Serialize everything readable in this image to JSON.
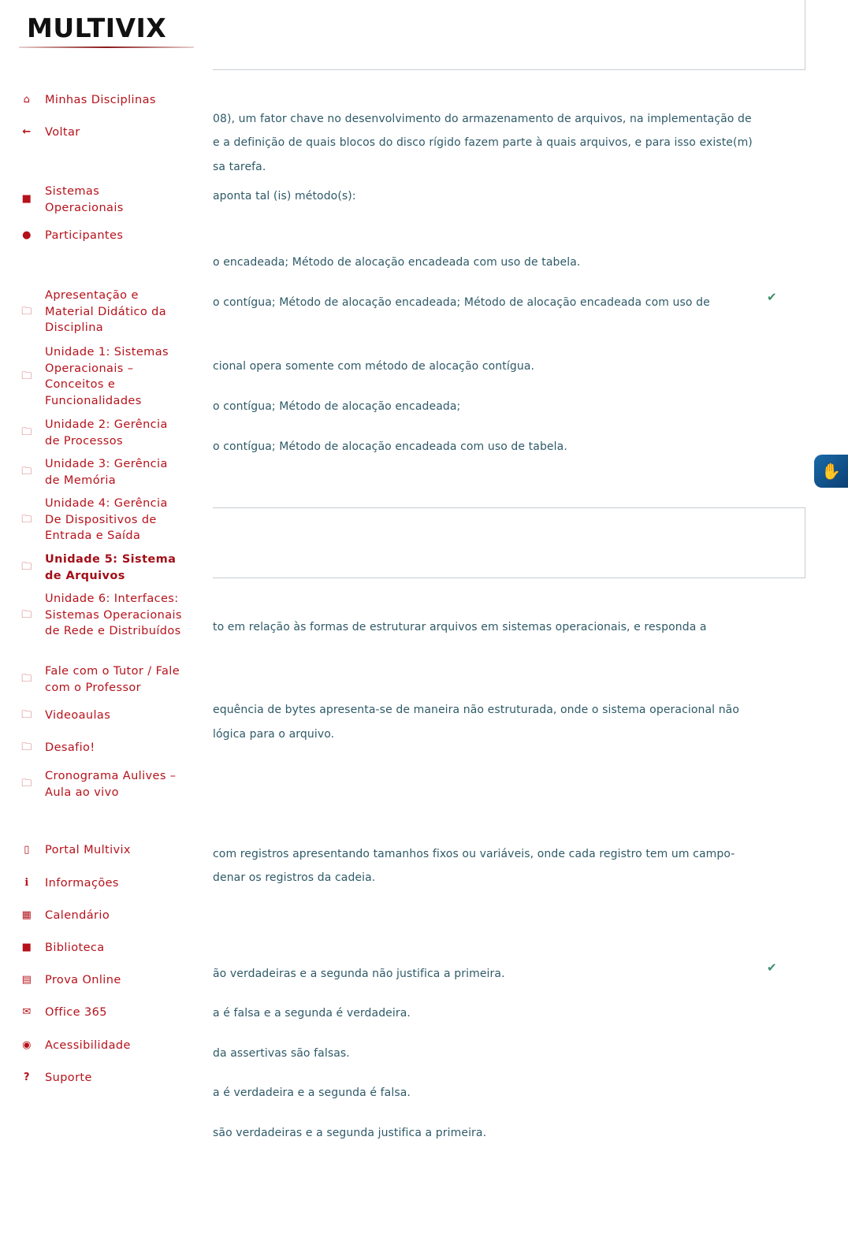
{
  "brand": {
    "logo_text": "MULTIVIX",
    "accent": "#b5121b",
    "text_color": "#2e5a68",
    "check_color": "#3e8e6a"
  },
  "sidebar": {
    "top_items": [
      {
        "label": "Minhas Disciplinas",
        "icon": "home-icon"
      },
      {
        "label": "Voltar",
        "icon": "arrow-left-icon"
      }
    ],
    "course_items": [
      {
        "label": "Sistemas Operacionais",
        "icon": "book-icon"
      },
      {
        "label": "Participantes",
        "icon": "users-icon"
      }
    ],
    "section_items": [
      {
        "label": "Apresentação e Material Didático da Disciplina",
        "icon": "folder-icon"
      },
      {
        "label": "Unidade 1: Sistemas Operacionais – Conceitos e Funcionalidades",
        "icon": "folder-icon"
      },
      {
        "label": "Unidade 2: Gerência de Processos",
        "icon": "folder-icon"
      },
      {
        "label": "Unidade 3: Gerência de Memória",
        "icon": "folder-icon"
      },
      {
        "label": "Unidade 4: Gerência De Dispositivos de Entrada e Saída",
        "icon": "folder-icon"
      },
      {
        "label": "Unidade 5: Sistema de Arquivos",
        "icon": "folder-icon",
        "active": true
      },
      {
        "label": "Unidade 6: Interfaces: Sistemas Operacionais de Rede e Distribuídos",
        "icon": "folder-icon"
      },
      {
        "label": "Fale com o Tutor / Fale com o Professor",
        "icon": "folder-icon"
      },
      {
        "label": "Videoaulas",
        "icon": "folder-icon"
      },
      {
        "label": "Desafio!",
        "icon": "folder-icon"
      },
      {
        "label": "Cronograma Aulives – Aula ao vivo",
        "icon": "folder-icon"
      }
    ],
    "bottom_items": [
      {
        "label": "Portal Multivix",
        "icon": "mobile-icon"
      },
      {
        "label": "Informações",
        "icon": "info-icon"
      },
      {
        "label": "Calendário",
        "icon": "calendar-icon"
      },
      {
        "label": "Biblioteca",
        "icon": "book-icon"
      },
      {
        "label": "Prova Online",
        "icon": "file-icon"
      },
      {
        "label": "Office 365",
        "icon": "envelope-icon"
      },
      {
        "label": "Acessibilidade",
        "icon": "accessibility-icon"
      },
      {
        "label": "Suporte",
        "icon": "question-icon"
      }
    ]
  },
  "question1": {
    "text_lines": [
      "08), um fator chave no desenvolvimento do armazenamento de arquivos, na implementação de",
      "e a definição de quais blocos do disco rígido fazem parte à quais arquivos, e para isso existe(m)",
      "sa tarefa.",
      "aponta tal (is) método(s):"
    ],
    "options": [
      {
        "text": "o encadeada; Método de alocação encadeada com uso de tabela.",
        "correct": false
      },
      {
        "text": "o contígua; Método de alocação encadeada; Método de alocação encadeada com uso de",
        "correct": true
      },
      {
        "text": "cional opera somente com método de alocação contígua.",
        "correct": false
      },
      {
        "text": "o contígua; Método de alocação encadeada;",
        "correct": false
      },
      {
        "text": "o contígua; Método de alocação encadeada com uso de tabela.",
        "correct": false
      }
    ]
  },
  "question2": {
    "text_lines": [
      "to em relação às formas de estruturar arquivos em sistemas operacionais, e responda a",
      "equência de bytes apresenta-se de maneira não estruturada, onde o sistema operacional não",
      "lógica para o arquivo.",
      "com registros apresentando tamanhos fixos ou variáveis, onde cada registro tem um campo-",
      "denar os registros da cadeia."
    ],
    "options": [
      {
        "text": "ão verdadeiras e a segunda não justifica a primeira.",
        "correct": true
      },
      {
        "text": "a é falsa e a segunda é verdadeira.",
        "correct": false
      },
      {
        "text": "da assertivas são falsas.",
        "correct": false
      },
      {
        "text": "a é verdadeira e a segunda é falsa.",
        "correct": false
      },
      {
        "text": "são verdadeiras e a segunda justifica a primeira.",
        "correct": false
      }
    ]
  },
  "vlibras": {
    "icon": "sign-language-icon"
  }
}
